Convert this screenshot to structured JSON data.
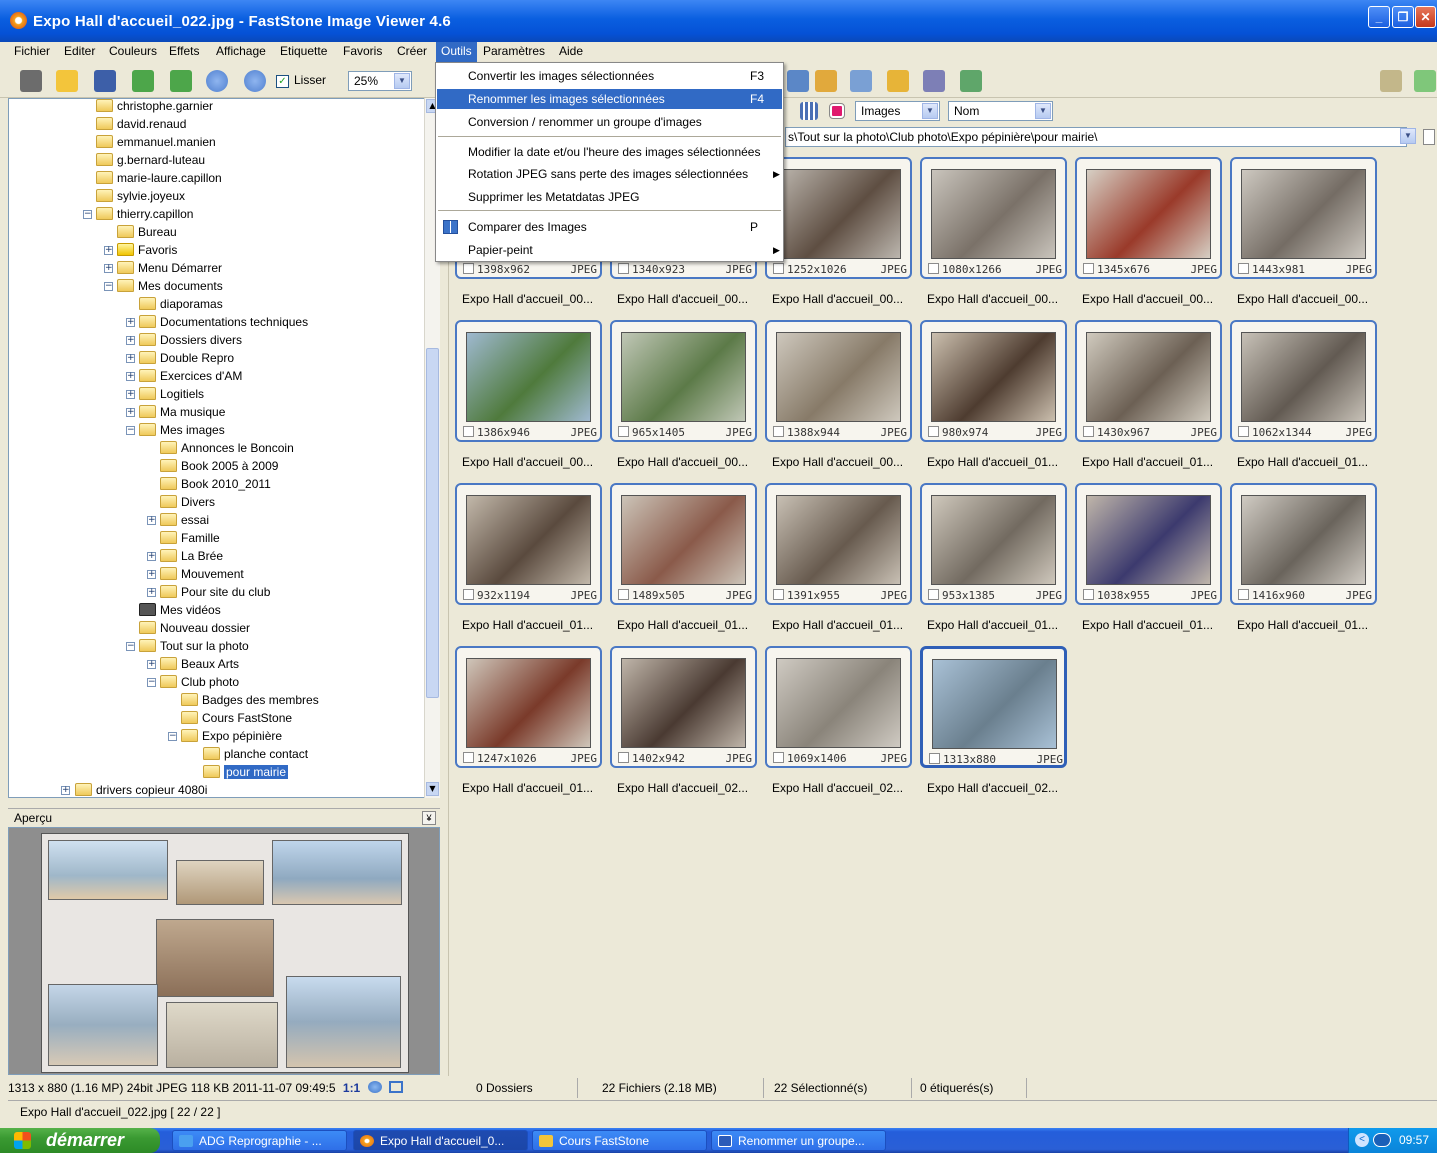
{
  "window": {
    "title": "Expo Hall d'accueil_022.jpg - FastStone Image Viewer 4.6",
    "min": "_",
    "max": "❐",
    "close": "✕"
  },
  "menubar": [
    "Fichier",
    "Editer",
    "Couleurs",
    "Effets",
    "Affichage",
    "Etiquette",
    "Favoris",
    "Créer",
    "Outils",
    "Paramètres",
    "Aide"
  ],
  "toolbar": {
    "smooth_label": "Lisser",
    "zoom": "25%",
    "filter": "Images",
    "sort": "Nom"
  },
  "outils_menu": [
    {
      "label": "Convertir les images sélectionnées",
      "key": "F3"
    },
    {
      "label": "Renommer les images sélectionnées",
      "key": "F4"
    },
    {
      "label": "Conversion / renommer un groupe d'images",
      "key": ""
    },
    {
      "label": "Modifier la date et/ou l'heure des images sélectionnées",
      "key": ""
    },
    {
      "label": "Rotation JPEG sans perte des images sélectionnées",
      "key": ""
    },
    {
      "label": "Supprimer les Metatdatas JPEG",
      "key": ""
    },
    {
      "label": "Comparer des Images",
      "key": "P"
    },
    {
      "label": "Papier-peint",
      "key": ""
    }
  ],
  "tree": [
    "christophe.garnier",
    "david.renaud",
    "emmanuel.manien",
    "g.bernard-luteau",
    "marie-laure.capillon",
    "sylvie.joyeux",
    "thierry.capillon",
    "Bureau",
    "Favoris",
    "Menu Démarrer",
    "Mes documents",
    "diaporamas",
    "Documentations techniques",
    "Dossiers divers",
    "Double Repro",
    "Exercices d'AM",
    "Logitiels",
    "Ma musique",
    "Mes images",
    "Annonces le Boncoin",
    "Book 2005 à 2009",
    "Book 2010_2011",
    "Divers",
    "essai",
    "Famille",
    "La Brée",
    "Mouvement",
    "Pour site du club",
    "Mes vidéos",
    "Nouveau dossier",
    "Tout sur la photo",
    "Beaux Arts",
    "Club photo",
    "Badges des membres",
    "Cours FastStone",
    "Expo pépinière",
    "planche contact",
    "pour mairie",
    "drivers copieur 4080i"
  ],
  "path": "s\\Tout sur la photo\\Club photo\\Expo pépinière\\pour mairie\\",
  "preview": {
    "label": "Aperçu",
    "status": "1313 x 880 (1.16 MP)  24bit  JPEG  118 KB  2011-11-07 09:49:5",
    "ratio": "1:1"
  },
  "thumbnails": [
    {
      "dims": "1398x962",
      "fmt": "JPEG",
      "name": "Expo Hall d'accueil_00..."
    },
    {
      "dims": "1340x923",
      "fmt": "JPEG",
      "name": "Expo Hall d'accueil_00..."
    },
    {
      "dims": "1252x1026",
      "fmt": "JPEG",
      "name": "Expo Hall d'accueil_00..."
    },
    {
      "dims": "1080x1266",
      "fmt": "JPEG",
      "name": "Expo Hall d'accueil_00..."
    },
    {
      "dims": "1345x676",
      "fmt": "JPEG",
      "name": "Expo Hall d'accueil_00..."
    },
    {
      "dims": "1443x981",
      "fmt": "JPEG",
      "name": "Expo Hall d'accueil_00..."
    },
    {
      "dims": "1386x946",
      "fmt": "JPEG",
      "name": "Expo Hall d'accueil_00..."
    },
    {
      "dims": "965x1405",
      "fmt": "JPEG",
      "name": "Expo Hall d'accueil_00..."
    },
    {
      "dims": "1388x944",
      "fmt": "JPEG",
      "name": "Expo Hall d'accueil_00..."
    },
    {
      "dims": "980x974",
      "fmt": "JPEG",
      "name": "Expo Hall d'accueil_01..."
    },
    {
      "dims": "1430x967",
      "fmt": "JPEG",
      "name": "Expo Hall d'accueil_01..."
    },
    {
      "dims": "1062x1344",
      "fmt": "JPEG",
      "name": "Expo Hall d'accueil_01..."
    },
    {
      "dims": "932x1194",
      "fmt": "JPEG",
      "name": "Expo Hall d'accueil_01..."
    },
    {
      "dims": "1489x505",
      "fmt": "JPEG",
      "name": "Expo Hall d'accueil_01..."
    },
    {
      "dims": "1391x955",
      "fmt": "JPEG",
      "name": "Expo Hall d'accueil_01..."
    },
    {
      "dims": "953x1385",
      "fmt": "JPEG",
      "name": "Expo Hall d'accueil_01..."
    },
    {
      "dims": "1038x955",
      "fmt": "JPEG",
      "name": "Expo Hall d'accueil_01..."
    },
    {
      "dims": "1416x960",
      "fmt": "JPEG",
      "name": "Expo Hall d'accueil_01..."
    },
    {
      "dims": "1247x1026",
      "fmt": "JPEG",
      "name": "Expo Hall d'accueil_01..."
    },
    {
      "dims": "1402x942",
      "fmt": "JPEG",
      "name": "Expo Hall d'accueil_02..."
    },
    {
      "dims": "1069x1406",
      "fmt": "JPEG",
      "name": "Expo Hall d'accueil_02..."
    },
    {
      "dims": "1313x880",
      "fmt": "JPEG",
      "name": "Expo Hall d'accueil_02..."
    }
  ],
  "status": {
    "dossiers": "0 Dossiers",
    "fichiers": "22 Fichiers (2.18 MB)",
    "selection": "22 Sélectionné(s)",
    "etiquetes": "0 étiquerés(s)"
  },
  "fileline": "Expo Hall d'accueil_022.jpg [ 22 / 22 ]",
  "taskbar": {
    "start": "démarrer",
    "tasks": [
      "ADG Reprographie - ...",
      "Expo Hall d'accueil_0...",
      "Cours FastStone",
      "Renommer un groupe..."
    ],
    "clock": "09:57"
  },
  "colors": {
    "selection": "#316ac5",
    "titlebar": "#0551d6",
    "thumb_border": "#4a78c4"
  }
}
